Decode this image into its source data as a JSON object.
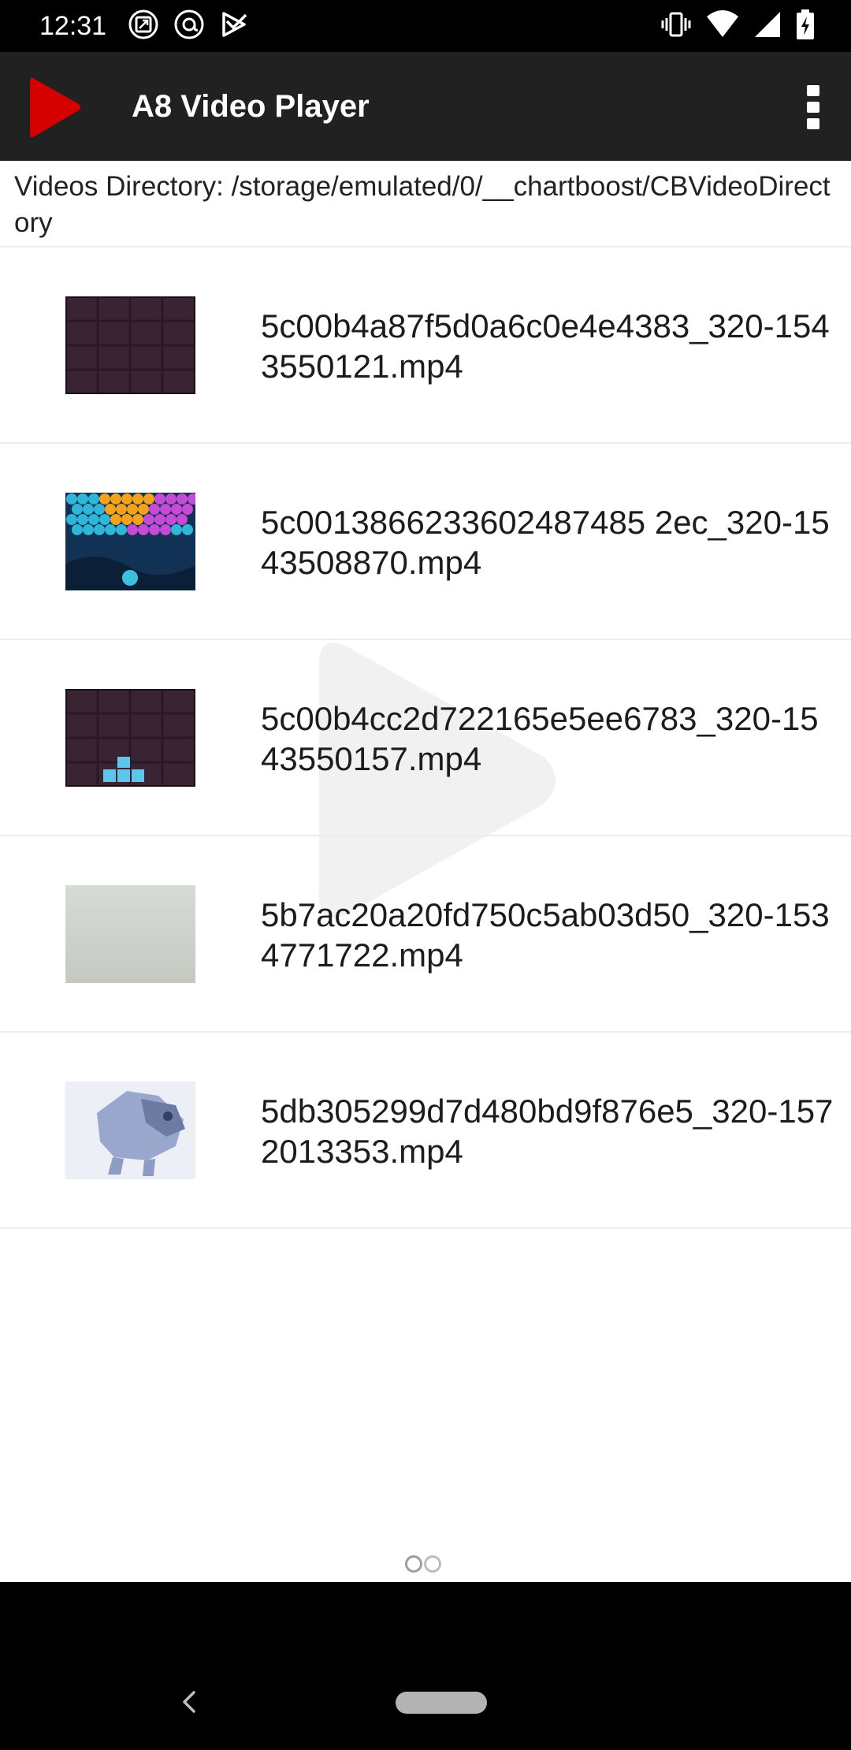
{
  "status_bar": {
    "time": "12:31",
    "left_icons": [
      "screenshot-icon",
      "at-sign-icon",
      "play-store-icon"
    ],
    "right_icons": [
      "vibrate-icon",
      "wifi-icon",
      "signal-icon",
      "battery-charging-icon"
    ]
  },
  "app_bar": {
    "title": "A8 Video Player",
    "logo_icon": "play-logo-icon",
    "menu_icon": "overflow-menu-icon",
    "accent_color": "#d50000",
    "background_color": "#212121"
  },
  "directory": {
    "text": "Videos Directory: /storage/emulated/0/__chartboost/CBVideoDirectory"
  },
  "videos": [
    {
      "name": "5c00b4a87f5d0a6c0e4e4383_320-1543550121.mp4",
      "thumbnail": "dark-purple-grid"
    },
    {
      "name": "5c0013866233602487485 2ec_320-1543508870.mp4",
      "thumbnail": "colorful-bubbles"
    },
    {
      "name": "5c00b4cc2d722165e5ee6783_320-1543550157.mp4",
      "thumbnail": "dark-purple-grid-blocks"
    },
    {
      "name": "5b7ac20a20fd750c5ab03d50_320-1534771722.mp4",
      "thumbnail": "light-gray"
    },
    {
      "name": "5db305299d7d480bd9f876e5_320-1572013353.mp4",
      "thumbnail": "blue-character"
    }
  ],
  "page_indicator": {
    "count": 2,
    "active": 1
  },
  "nav_bar": {
    "back_icon": "back-chevron-icon",
    "home_icon": "home-pill-icon"
  }
}
